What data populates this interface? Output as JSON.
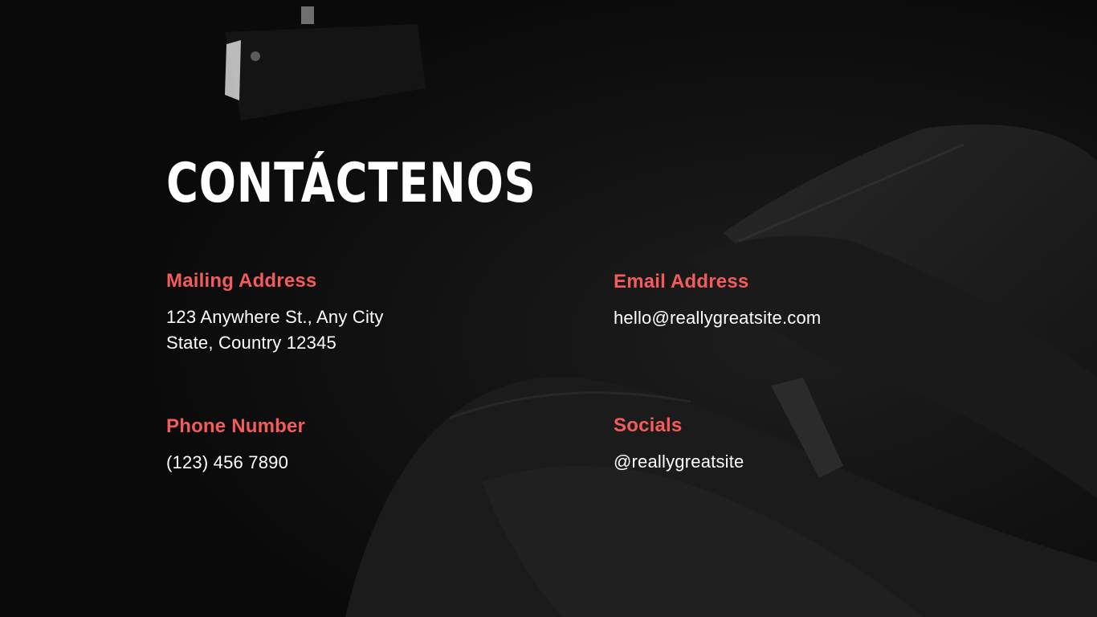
{
  "slide": {
    "title": "CONTÁCTENOS"
  },
  "contacts": {
    "mailing": {
      "label": "Mailing Address",
      "line1": "123 Anywhere St., Any City",
      "line2": "State, Country 12345"
    },
    "email": {
      "label": "Email Address",
      "value": "hello@reallygreatsite.com"
    },
    "phone": {
      "label": "Phone Number",
      "value": "(123) 456 7890"
    },
    "socials": {
      "label": "Socials",
      "value": "@reallygreatsite"
    }
  },
  "colors": {
    "background": "#0a0a0a",
    "accent": "#f45b5b",
    "text": "#ffffff"
  }
}
